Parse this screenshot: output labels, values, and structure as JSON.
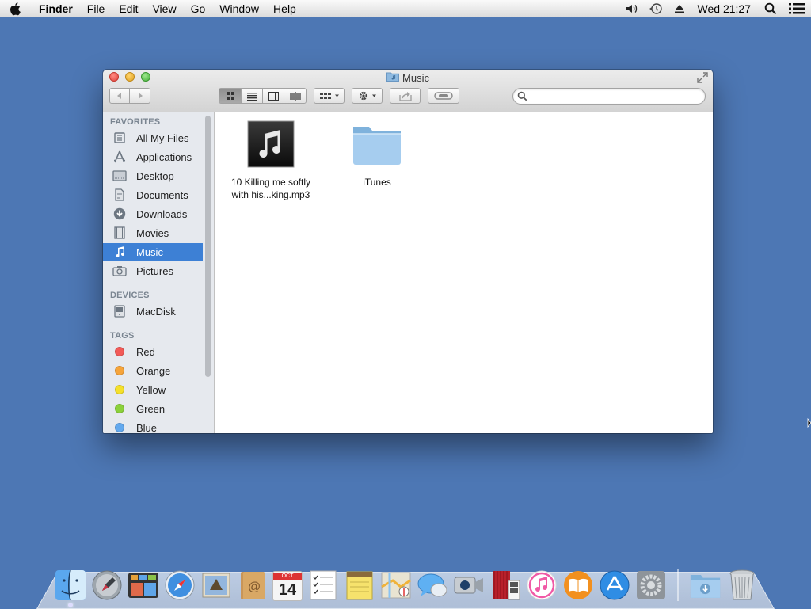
{
  "menubar": {
    "apple_icon": "apple-logo-icon",
    "app_name": "Finder",
    "items": [
      "File",
      "Edit",
      "View",
      "Go",
      "Window",
      "Help"
    ],
    "status_icons": [
      "volume-icon",
      "time-machine-icon",
      "eject-icon"
    ],
    "clock": "Wed 21:27",
    "spotlight_icon": "search-icon",
    "notifications_icon": "list-icon"
  },
  "window": {
    "title": "Music",
    "title_icon": "music-folder-icon",
    "search": {
      "placeholder": "",
      "value": ""
    },
    "view_modes": [
      "icon-view",
      "list-view",
      "column-view",
      "cover-flow-view"
    ],
    "active_view": "icon-view"
  },
  "sidebar": {
    "favorites_heading": "FAVORITES",
    "favorites": [
      {
        "label": "All My Files",
        "icon": "all-files-icon"
      },
      {
        "label": "Applications",
        "icon": "applications-icon"
      },
      {
        "label": "Desktop",
        "icon": "desktop-icon"
      },
      {
        "label": "Documents",
        "icon": "documents-icon"
      },
      {
        "label": "Downloads",
        "icon": "downloads-icon"
      },
      {
        "label": "Movies",
        "icon": "movies-icon"
      },
      {
        "label": "Music",
        "icon": "music-note-icon",
        "selected": true
      },
      {
        "label": "Pictures",
        "icon": "camera-icon"
      }
    ],
    "devices_heading": "DEVICES",
    "devices": [
      {
        "label": "MacDisk",
        "icon": "disk-icon"
      }
    ],
    "tags_heading": "TAGS",
    "tags": [
      {
        "label": "Red",
        "color": "#f25a57"
      },
      {
        "label": "Orange",
        "color": "#f6a43a"
      },
      {
        "label": "Yellow",
        "color": "#f5e02a"
      },
      {
        "label": "Green",
        "color": "#8bd13a"
      },
      {
        "label": "Blue",
        "color": "#63a9ee"
      }
    ]
  },
  "files": [
    {
      "name_line1": "10 Killing me softly",
      "name_line2": "with his...king.mp3",
      "icon": "mp3-file-icon"
    },
    {
      "name_line1": "iTunes",
      "name_line2": "",
      "icon": "folder-icon"
    }
  ],
  "dock": {
    "apps": [
      "finder-icon",
      "launchpad-icon",
      "mission-control-icon",
      "safari-icon",
      "mail-icon",
      "contacts-icon",
      "calendar-icon",
      "reminders-icon",
      "notes-icon",
      "maps-icon",
      "messages-icon",
      "facetime-icon",
      "photo-booth-icon",
      "itunes-icon",
      "ibooks-icon",
      "app-store-icon",
      "system-preferences-icon"
    ],
    "calendar_day": "14",
    "calendar_month": "OCT",
    "stacks": [
      "downloads-stack-icon",
      "trash-icon"
    ]
  },
  "colors": {
    "desktop": "#4d77b4",
    "selection": "#3d80d5"
  }
}
